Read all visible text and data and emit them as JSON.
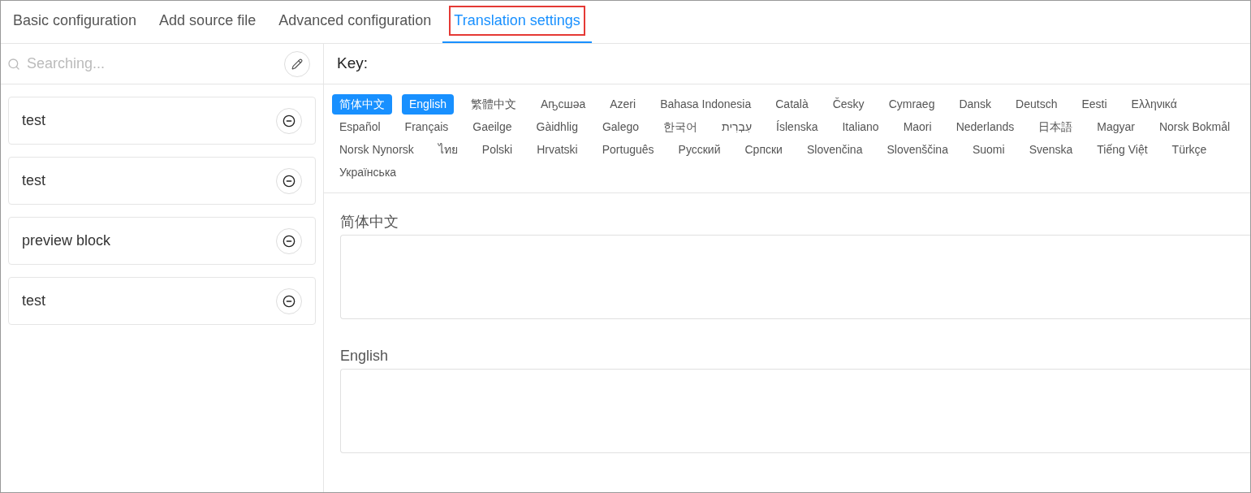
{
  "tabs": [
    {
      "label": "Basic configuration",
      "selected": false,
      "highlighted": false
    },
    {
      "label": "Add source file",
      "selected": false,
      "highlighted": false
    },
    {
      "label": "Advanced configuration",
      "selected": false,
      "highlighted": false
    },
    {
      "label": "Translation settings",
      "selected": true,
      "highlighted": true
    }
  ],
  "search": {
    "placeholder": "Searching..."
  },
  "items": [
    {
      "label": "test"
    },
    {
      "label": "test"
    },
    {
      "label": "preview block"
    },
    {
      "label": "test"
    }
  ],
  "key_label": "Key:",
  "languages": [
    {
      "label": "简体中文",
      "selected": true
    },
    {
      "label": "English",
      "selected": true
    },
    {
      "label": "繁體中文",
      "selected": false
    },
    {
      "label": "Аҧсшәа",
      "selected": false
    },
    {
      "label": "Azeri",
      "selected": false
    },
    {
      "label": "Bahasa Indonesia",
      "selected": false
    },
    {
      "label": "Català",
      "selected": false
    },
    {
      "label": "Česky",
      "selected": false
    },
    {
      "label": "Cymraeg",
      "selected": false
    },
    {
      "label": "Dansk",
      "selected": false
    },
    {
      "label": "Deutsch",
      "selected": false
    },
    {
      "label": "Eesti",
      "selected": false
    },
    {
      "label": "Ελληνικά",
      "selected": false
    },
    {
      "label": "Español",
      "selected": false
    },
    {
      "label": "Français",
      "selected": false
    },
    {
      "label": "Gaeilge",
      "selected": false
    },
    {
      "label": "Gàidhlig",
      "selected": false
    },
    {
      "label": "Galego",
      "selected": false
    },
    {
      "label": "한국어",
      "selected": false
    },
    {
      "label": "עִבְרִית",
      "selected": false
    },
    {
      "label": "Íslenska",
      "selected": false
    },
    {
      "label": "Italiano",
      "selected": false
    },
    {
      "label": "Maori",
      "selected": false
    },
    {
      "label": "Nederlands",
      "selected": false
    },
    {
      "label": "日本語",
      "selected": false
    },
    {
      "label": "Magyar",
      "selected": false
    },
    {
      "label": "Norsk Bokmål",
      "selected": false
    },
    {
      "label": "Norsk Nynorsk",
      "selected": false
    },
    {
      "label": "ไทย",
      "selected": false
    },
    {
      "label": "Polski",
      "selected": false
    },
    {
      "label": "Hrvatski",
      "selected": false
    },
    {
      "label": "Português",
      "selected": false
    },
    {
      "label": "Русский",
      "selected": false
    },
    {
      "label": "Српски",
      "selected": false
    },
    {
      "label": "Slovenčina",
      "selected": false
    },
    {
      "label": "Slovenščina",
      "selected": false
    },
    {
      "label": "Suomi",
      "selected": false
    },
    {
      "label": "Svenska",
      "selected": false
    },
    {
      "label": "Tiếng Việt",
      "selected": false
    },
    {
      "label": "Türkçe",
      "selected": false
    },
    {
      "label": "Українська",
      "selected": false
    }
  ],
  "translations": [
    {
      "label": "简体中文"
    },
    {
      "label": "English"
    }
  ]
}
